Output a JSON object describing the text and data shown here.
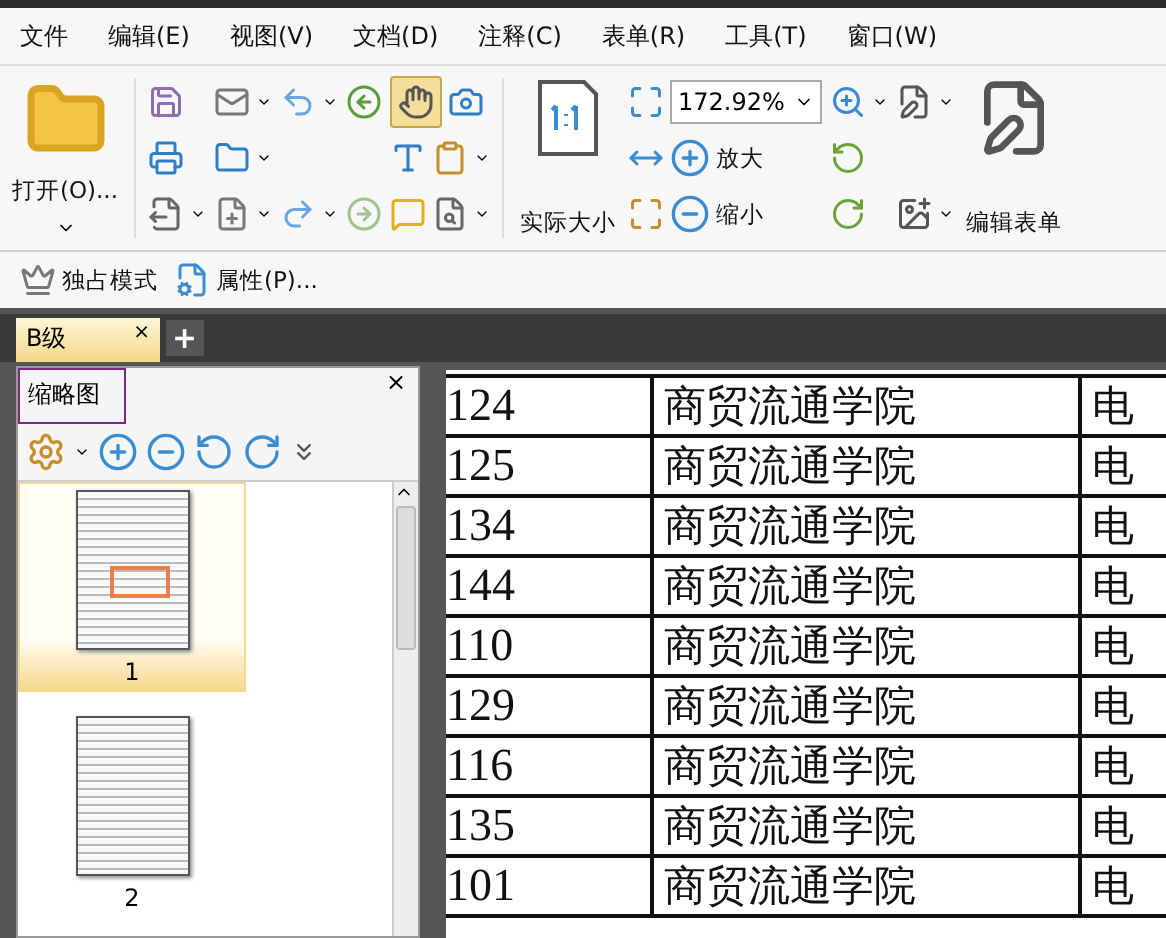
{
  "menu": [
    "文件",
    "编辑(E)",
    "视图(V)",
    "文档(D)",
    "注释(C)",
    "表单(R)",
    "工具(T)",
    "窗口(W)"
  ],
  "toolbar": {
    "open_label": "打开(O)...",
    "actual_size_label": "实际大小",
    "zoom_value": "172.92%",
    "zoom_in_label": "放大",
    "zoom_out_label": "缩小",
    "edit_form_label": "编辑表单",
    "hand_tool_selected": true
  },
  "secondary_toolbar": [
    "独占模式",
    "属性(P)..."
  ],
  "tabs": [
    {
      "label": "B级",
      "selected": true,
      "close": "×"
    }
  ],
  "new_tab": "+",
  "thumbnail_panel": {
    "title": "缩略图",
    "close": "×",
    "pages": [
      {
        "label": "1",
        "selected": true
      },
      {
        "label": "2",
        "selected": false
      }
    ]
  },
  "table": {
    "rows": [
      {
        "column_1": "124",
        "column_2": "商贸流通学院",
        "column_3": "电"
      },
      {
        "column_1": "125",
        "column_2": "商贸流通学院",
        "column_3": "电"
      },
      {
        "column_1": "134",
        "column_2": "商贸流通学院",
        "column_3": "电"
      },
      {
        "column_1": "144",
        "column_2": "商贸流通学院",
        "column_3": "电"
      },
      {
        "column_1": "110",
        "column_2": "商贸流通学院",
        "column_3": "电"
      },
      {
        "column_1": "129",
        "column_2": "商贸流通学院",
        "column_3": "电"
      },
      {
        "column_1": "116",
        "column_2": "商贸流通学院",
        "column_3": "电"
      },
      {
        "column_1": "135",
        "column_2": "商贸流通学院",
        "column_3": "电"
      },
      {
        "column_1": "101",
        "column_2": "商贸流通学院",
        "column_3": "电"
      }
    ]
  }
}
